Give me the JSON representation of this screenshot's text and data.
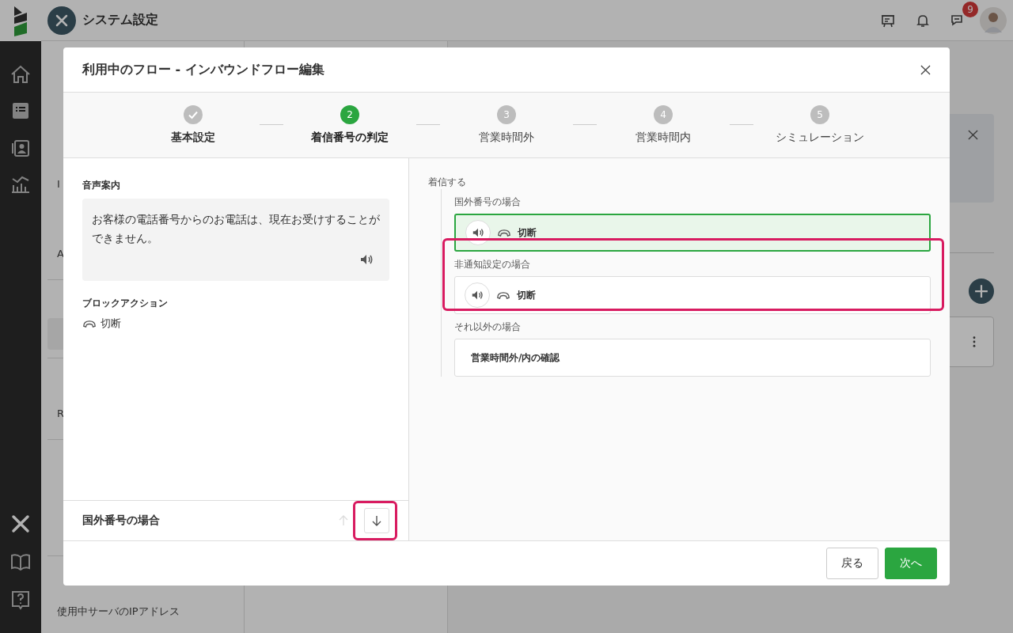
{
  "app": {
    "title": "システム設定",
    "notification_count": "9"
  },
  "sidebar": {
    "items": [
      {
        "kind": "item"
      },
      {
        "kind": "item"
      },
      {
        "kind": "item"
      },
      {
        "kind": "item",
        "text": "I"
      },
      {
        "kind": "item"
      },
      {
        "kind": "item",
        "text": "A"
      },
      {
        "kind": "section"
      },
      {
        "kind": "active-item"
      },
      {
        "kind": "section"
      },
      {
        "kind": "item",
        "text": "R"
      },
      {
        "kind": "section"
      },
      {
        "kind": "item"
      },
      {
        "kind": "item"
      },
      {
        "kind": "section"
      },
      {
        "kind": "item",
        "text": "使用中サーバのIPアドレス"
      }
    ]
  },
  "dialog": {
    "title": "利用中のフロー - インバウンドフロー編集",
    "steps": [
      {
        "label": "基本設定",
        "done": true,
        "selected": false
      },
      {
        "number": "2",
        "label": "着信番号の判定",
        "done": false,
        "selected": true
      },
      {
        "number": "3",
        "label": "営業時間外",
        "done": false,
        "selected": false
      },
      {
        "number": "4",
        "label": "営業時間内",
        "done": false,
        "selected": false
      },
      {
        "number": "5",
        "label": "シミュレーション",
        "done": false,
        "selected": false
      }
    ],
    "detail": {
      "voice_label": "音声案内",
      "voice_message": "お客様の電話番号からのお電話は、現在お受けすることができません。",
      "action_label": "ブロックアクション",
      "action": "切断",
      "footer_title": "国外番号の場合",
      "move_up_disabled": true,
      "move_down_disabled": false
    },
    "flow": {
      "root": "着信する",
      "branches": [
        {
          "label": "国外番号の場合",
          "kind": "action",
          "action": "切断",
          "selected": true
        },
        {
          "label": "非通知設定の場合",
          "kind": "action",
          "action": "切断",
          "selected": false
        },
        {
          "label": "それ以外の場合",
          "kind": "next",
          "action": "営業時間外/内の確認",
          "selected": false
        }
      ]
    },
    "buttons": [
      {
        "label": "戻る",
        "kind": "secondary"
      },
      {
        "label": "次へ",
        "kind": "primary"
      }
    ]
  }
}
